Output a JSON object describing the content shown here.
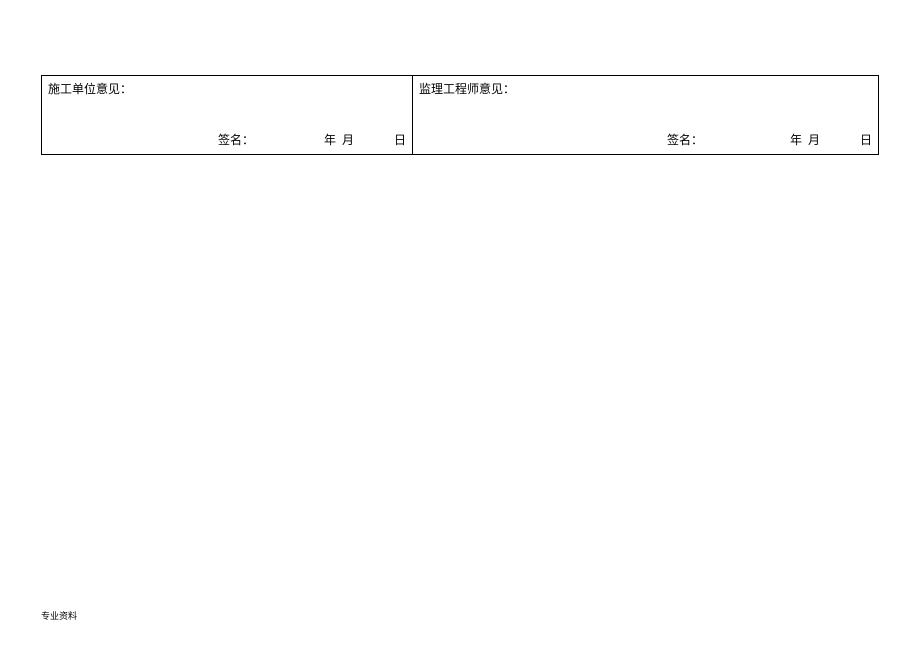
{
  "form": {
    "left": {
      "title": "施工单位意见：",
      "signature_label": "签名：",
      "date_year_month": "年  月",
      "date_day": "日"
    },
    "right": {
      "title": "监理工程师意见：",
      "signature_label": "签名：",
      "date_year_month": "年  月",
      "date_day": "日"
    }
  },
  "footer": {
    "text": "专业资料"
  }
}
